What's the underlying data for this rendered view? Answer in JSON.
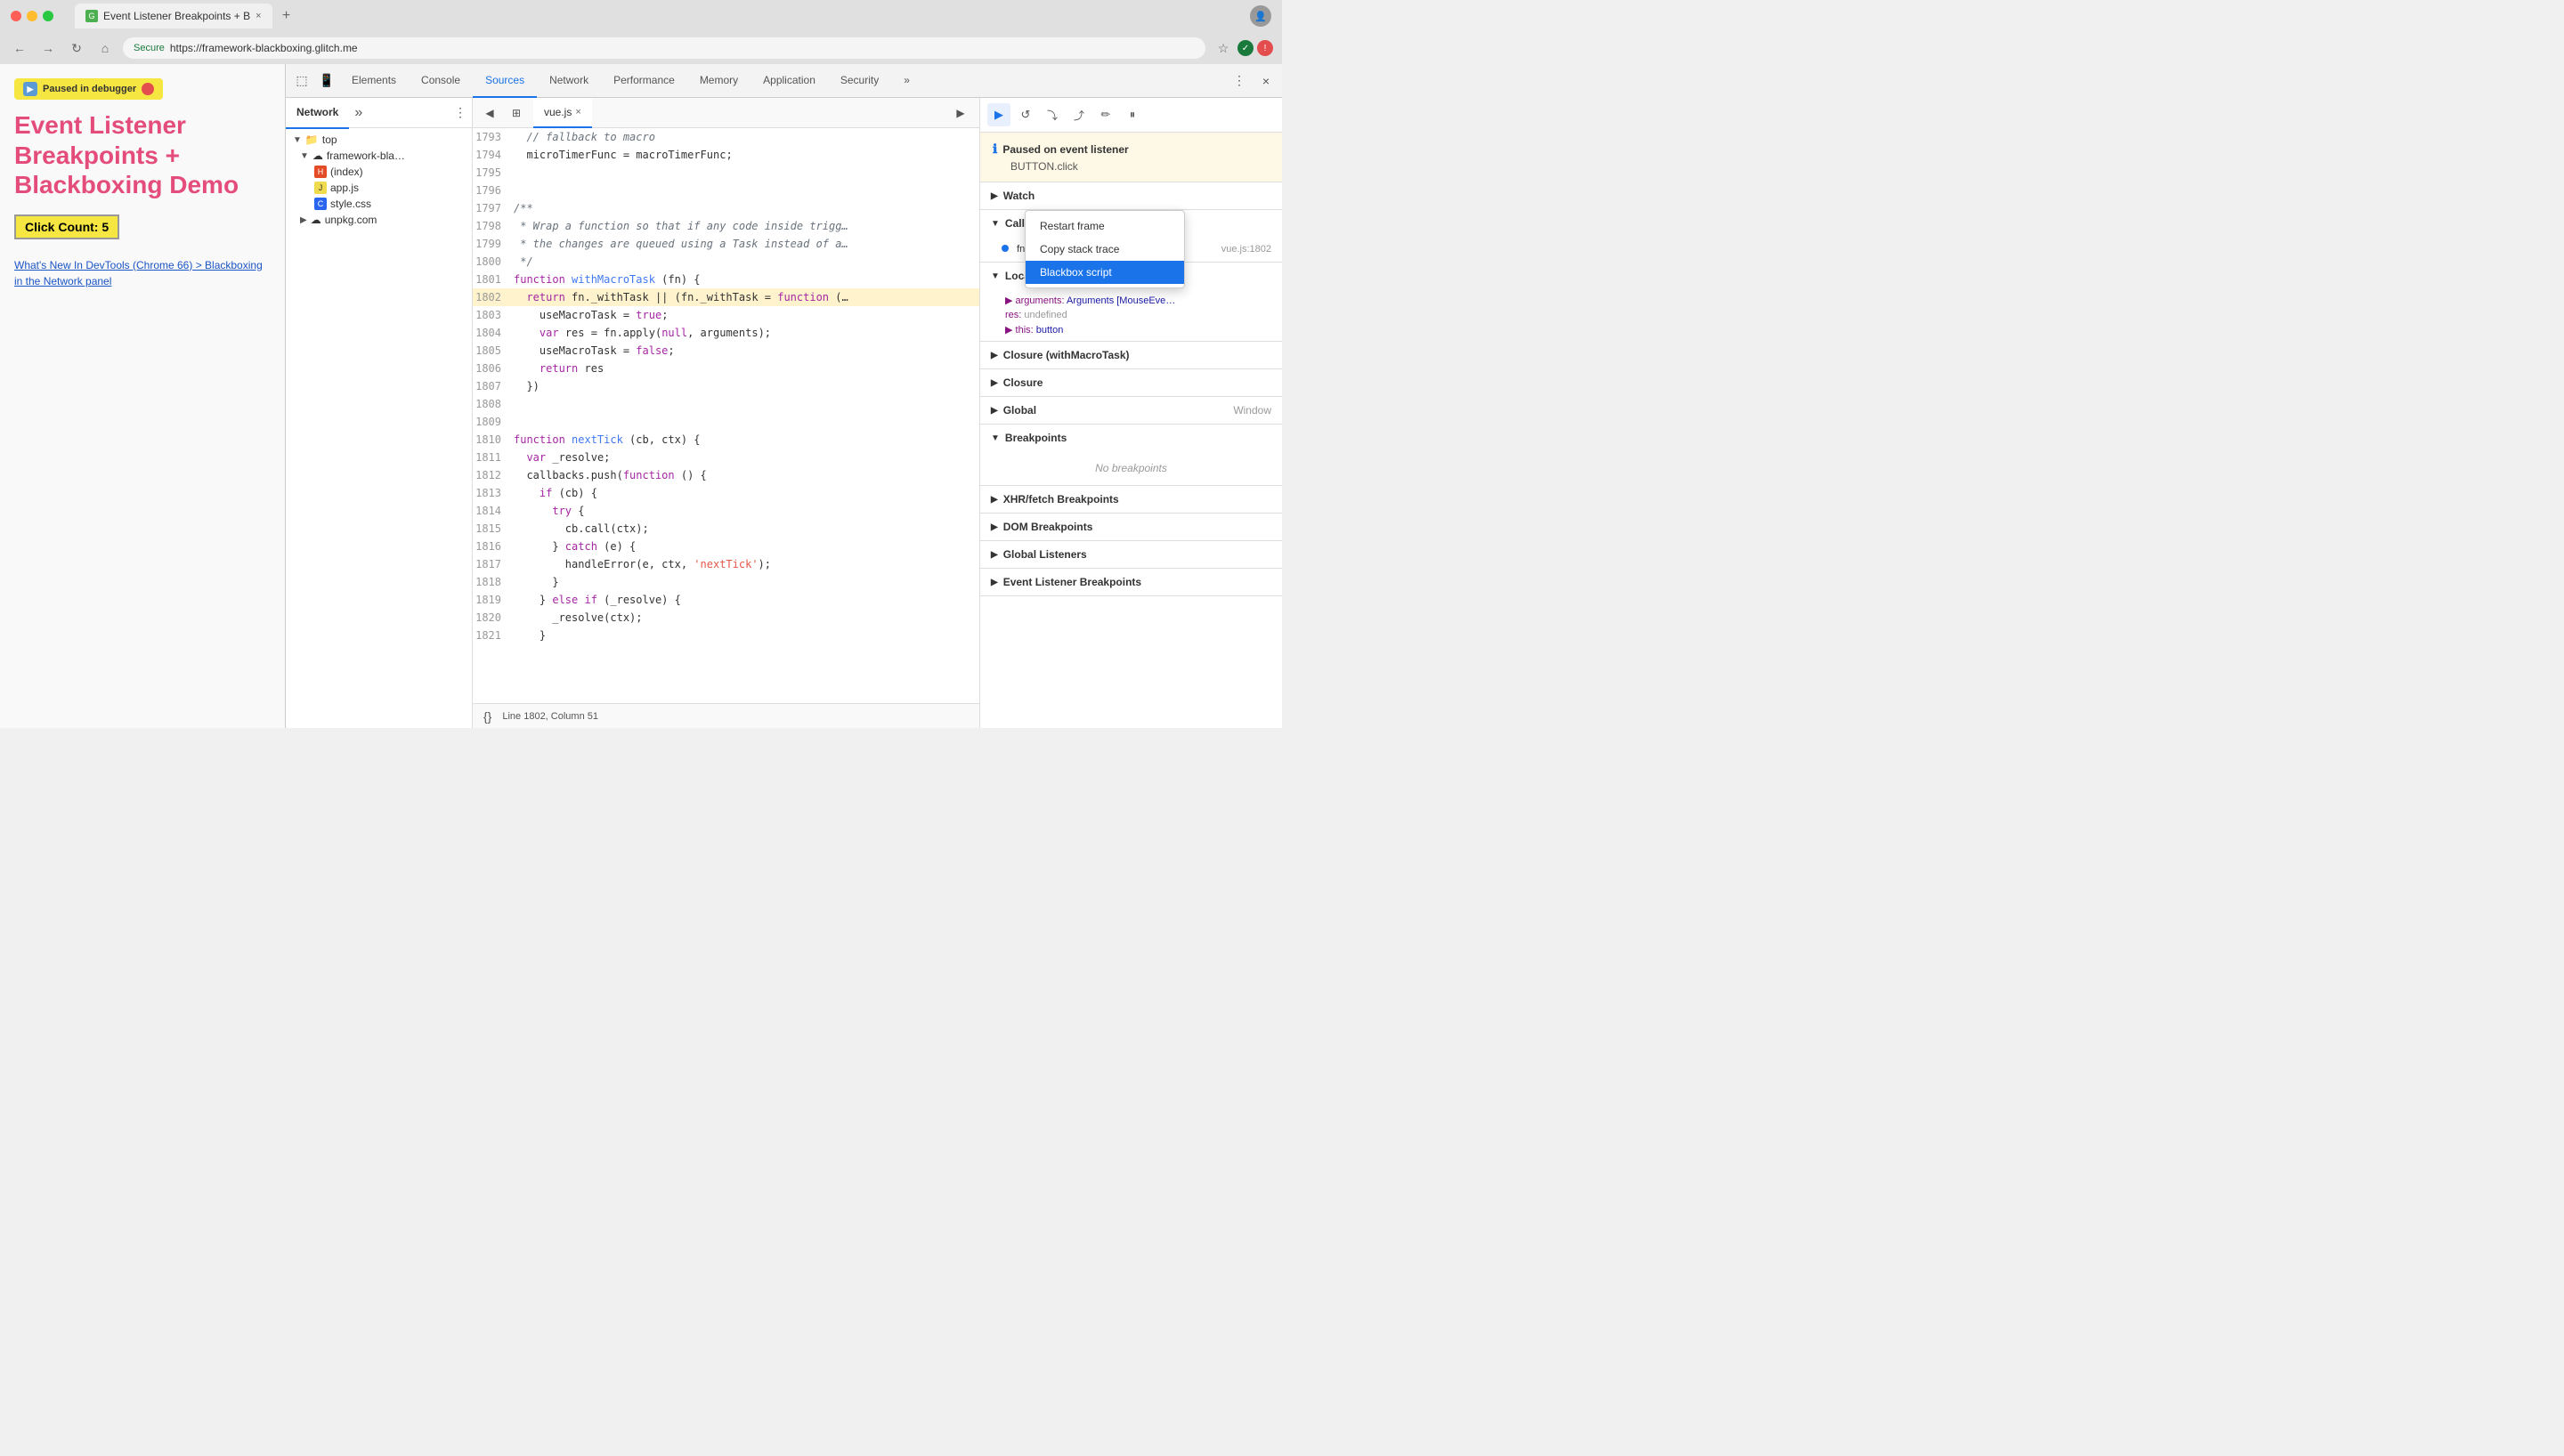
{
  "browser": {
    "tab_title": "Event Listener Breakpoints + B",
    "tab_close": "×",
    "new_tab": "+",
    "url_secure": "Secure",
    "url": "https://framework-blackboxing.glitch.me",
    "nav_back": "←",
    "nav_forward": "→",
    "nav_refresh": "↻",
    "nav_home": "⌂"
  },
  "page": {
    "paused_label": "Paused in debugger",
    "title": "Event Listener Breakpoints + Blackboxing Demo",
    "click_count": "Click Count: 5",
    "links": [
      "What's New In DevTools (Chrome 66) > Blackboxing in the Network panel"
    ]
  },
  "devtools": {
    "tabs": [
      {
        "label": "Elements",
        "active": false
      },
      {
        "label": "Console",
        "active": false
      },
      {
        "label": "Sources",
        "active": true
      },
      {
        "label": "Network",
        "active": false
      },
      {
        "label": "Performance",
        "active": false
      },
      {
        "label": "Memory",
        "active": false
      },
      {
        "label": "Application",
        "active": false
      },
      {
        "label": "Security",
        "active": false
      }
    ],
    "more_tabs": "»",
    "menu_icon": "⋮",
    "close_icon": "×"
  },
  "sources_sidebar": {
    "network_tab": "Network",
    "more_btn": "»",
    "kebab": "⋮",
    "tree": [
      {
        "type": "folder",
        "label": "top",
        "indent": 0,
        "expanded": true,
        "arrow": "▼"
      },
      {
        "type": "folder",
        "label": "framework-bla…",
        "indent": 1,
        "expanded": true,
        "arrow": "▼",
        "cloud": true
      },
      {
        "type": "file",
        "label": "(index)",
        "indent": 2,
        "filetype": "html"
      },
      {
        "type": "file",
        "label": "app.js",
        "indent": 2,
        "filetype": "js"
      },
      {
        "type": "file",
        "label": "style.css",
        "indent": 2,
        "filetype": "css"
      },
      {
        "type": "folder",
        "label": "unpkg.com",
        "indent": 1,
        "expanded": false,
        "arrow": "▶",
        "cloud": true
      }
    ]
  },
  "editor": {
    "active_tab": "vue.js",
    "tab_close": "×",
    "lines": [
      {
        "num": 1793,
        "content": "  // fallback to macro",
        "type": "comment"
      },
      {
        "num": 1794,
        "content": "  microTimerFunc = macroTimerFunc;",
        "type": "code"
      },
      {
        "num": 1795,
        "content": "",
        "type": "code"
      },
      {
        "num": 1796,
        "content": "",
        "type": "code"
      },
      {
        "num": 1797,
        "content": "/**",
        "type": "comment"
      },
      {
        "num": 1798,
        "content": " * Wrap a function so that if any code inside trigg…",
        "type": "comment"
      },
      {
        "num": 1799,
        "content": " * the changes are queued using a Task instead of a…",
        "type": "comment"
      },
      {
        "num": 1800,
        "content": " */",
        "type": "comment"
      },
      {
        "num": 1801,
        "content": "function withMacroTask (fn) {",
        "type": "code"
      },
      {
        "num": 1802,
        "content": "  return fn._withTask || (fn._withTask = function (…",
        "type": "highlighted"
      },
      {
        "num": 1803,
        "content": "    useMacroTask = true;",
        "type": "code"
      },
      {
        "num": 1804,
        "content": "    var res = fn.apply(null, arguments);",
        "type": "code"
      },
      {
        "num": 1805,
        "content": "    useMacroTask = false;",
        "type": "code"
      },
      {
        "num": 1806,
        "content": "    return res",
        "type": "code"
      },
      {
        "num": 1807,
        "content": "  })",
        "type": "code"
      },
      {
        "num": 1808,
        "content": "",
        "type": "code"
      },
      {
        "num": 1809,
        "content": "",
        "type": "code"
      },
      {
        "num": 1810,
        "content": "function nextTick (cb, ctx) {",
        "type": "code"
      },
      {
        "num": 1811,
        "content": "  var _resolve;",
        "type": "code"
      },
      {
        "num": 1812,
        "content": "  callbacks.push(function () {",
        "type": "code"
      },
      {
        "num": 1813,
        "content": "    if (cb) {",
        "type": "code"
      },
      {
        "num": 1814,
        "content": "      try {",
        "type": "code"
      },
      {
        "num": 1815,
        "content": "        cb.call(ctx);",
        "type": "code"
      },
      {
        "num": 1816,
        "content": "      } catch (e) {",
        "type": "code"
      },
      {
        "num": 1817,
        "content": "        handleError(e, ctx, 'nextTick');",
        "type": "code"
      },
      {
        "num": 1818,
        "content": "      }",
        "type": "code"
      },
      {
        "num": 1819,
        "content": "    } else if (_resolve) {",
        "type": "code"
      },
      {
        "num": 1820,
        "content": "      _resolve(ctx);",
        "type": "code"
      },
      {
        "num": 1821,
        "content": "    }",
        "type": "code"
      }
    ],
    "status_line": "Line 1802, Column 51"
  },
  "right_panel": {
    "debug_buttons": [
      {
        "icon": "▶",
        "label": "resume",
        "active": true
      },
      {
        "icon": "↺",
        "label": "step-over"
      },
      {
        "icon": "↓",
        "label": "step-into"
      },
      {
        "icon": "↑",
        "label": "step-out"
      },
      {
        "icon": "✏",
        "label": "deactivate"
      },
      {
        "icon": "⏸",
        "label": "pause-on-exception"
      }
    ],
    "paused_title": "Paused on event listener",
    "paused_subtitle": "BUTTON.click",
    "watch_label": "Watch",
    "call_stack_label": "Call Stack",
    "call_stack_items": [
      {
        "fn": "fn._withTask.fn._withTask",
        "location": "vue.js:1802",
        "active": true
      }
    ],
    "context_menu": {
      "items": [
        {
          "label": "Restart frame",
          "selected": false
        },
        {
          "label": "Copy stack trace",
          "selected": false
        },
        {
          "label": "Blackbox script",
          "selected": true
        }
      ]
    },
    "scope_label": "Local",
    "scope_items": [
      {
        "key": "▶ arguments:",
        "value": "Arguments [MouseEve…"
      },
      {
        "key": "res:",
        "value": "undefined"
      },
      {
        "key": "▶ this:",
        "value": "button"
      }
    ],
    "closure_items": [
      {
        "label": "Closure (withMacroTask)",
        "expanded": false
      },
      {
        "label": "Closure",
        "expanded": false
      },
      {
        "label": "Global",
        "value": "Window",
        "expanded": false
      }
    ],
    "breakpoints_label": "Breakpoints",
    "no_breakpoints": "No breakpoints",
    "xhr_label": "XHR/fetch Breakpoints",
    "dom_label": "DOM Breakpoints",
    "global_listeners_label": "Global Listeners",
    "event_listener_label": "Event Listener Breakpoints"
  }
}
